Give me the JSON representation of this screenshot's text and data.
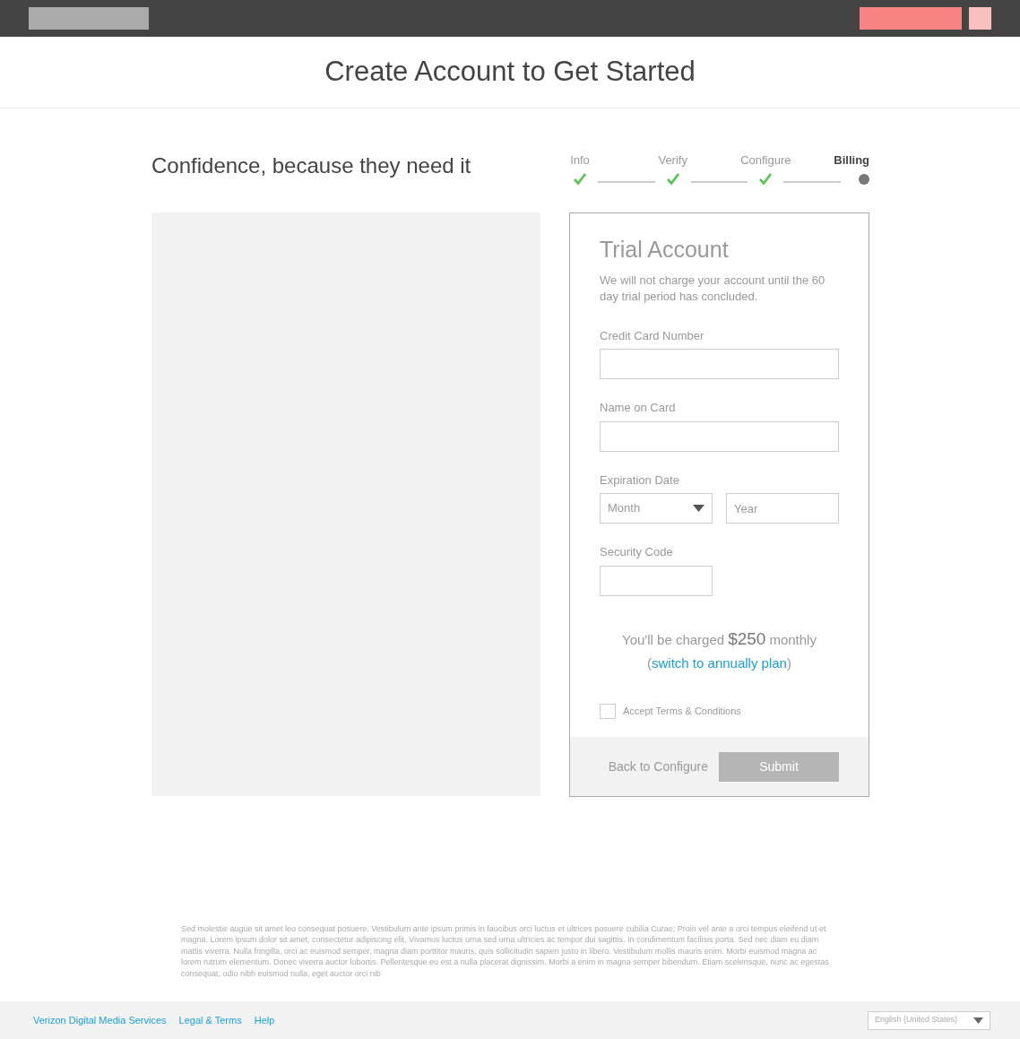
{
  "page_title": "Create Account to Get Started",
  "tagline": "Confidence, because they need it",
  "steps": [
    {
      "label": "Info",
      "kind": "done"
    },
    {
      "label": "Verify",
      "kind": "done"
    },
    {
      "label": "Configure",
      "kind": "done"
    },
    {
      "label": "Billing",
      "kind": "current"
    }
  ],
  "form": {
    "title": "Trial Account",
    "description": "We will not charge your account until the 60 day trial period has concluded.",
    "fields": [
      {
        "label": "Credit Card Number",
        "kind": "text"
      },
      {
        "label": "Name on Card",
        "kind": "text"
      },
      {
        "label": "Expiration Date",
        "kind": "expiry",
        "month_placeholder": "Month",
        "year_placeholder": "Year"
      },
      {
        "label": "Security Code",
        "kind": "short_text"
      }
    ],
    "charge": {
      "prefix": "You'll be charged",
      "amount": "$250",
      "suffix": "monthly",
      "open_paren": "(",
      "link": "switch to annually plan",
      "close_paren": ")"
    },
    "terms": {
      "label": "Accept Terms & Conditions",
      "checked": false
    },
    "back_button": "Back to Configure",
    "submit": {
      "label": "Submit",
      "disabled": true
    }
  },
  "legal_text": "Sed molestie augue sit amet leo consequat posuere. Vestibulum ante ipsum primis in faucibus orci luctus et ultrices posuere cubilia Curae; Proin vel ante a orci tempus eleifend ut et magna. Lorem ipsum dolor sit amet, consectetur adipiscing elit. Vivamus luctus urna sed urna ultricies ac tempor dui sagittis. In condimentum facilisis porta. Sed nec diam eu diam mattis viverra. Nulla fringilla, orci ac euismod semper, magna diam porttitor mauris, quis sollicitudin sapien justo in libero. Vestibulum mollis mauris enim. Morbi euismod magna ac lorem rutrum elementum. Donec viverra auctor lobortis. Pellentesque eu est a nulla placerat dignissim. Morbi a enim in magna semper bibendum. Etiam scelerisque, nunc ac egestas consequat, odio nibh euismod nulla, eget auctor orci nib",
  "footer": {
    "links": [
      "Verizon Digital Media Services",
      "Legal & Terms",
      "Help"
    ],
    "language": "English (United States)"
  }
}
